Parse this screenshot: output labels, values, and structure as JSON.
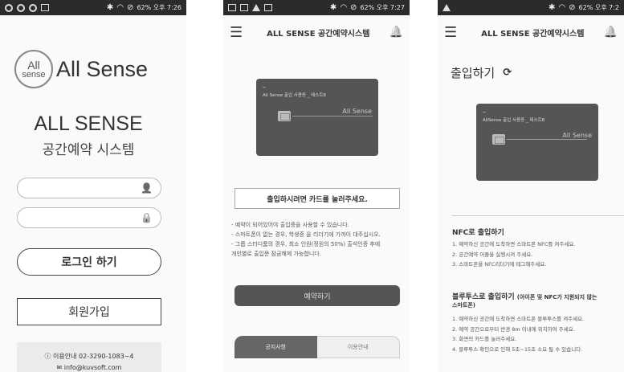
{
  "screens": {
    "login": {
      "status": {
        "right": "62%  오후 7:26"
      },
      "logo": {
        "circle_line1": "All",
        "circle_line2": "sense",
        "text": "All Sense"
      },
      "title": "ALL SENSE",
      "subtitle": "공간예약 시스템",
      "id_field": {
        "value": "",
        "placeholder": "",
        "icon": "person-icon"
      },
      "pw_field": {
        "value": "",
        "placeholder": "",
        "icon": "lock-icon"
      },
      "login_button": "로그인 하기",
      "join_button": "회원가입",
      "contact_line1": "이용안내 02-3290-1083~4",
      "contact_line2": "info@kuvsoft.com"
    },
    "card": {
      "status": {
        "right": "62%  오후 7:27"
      },
      "appbar_title": "ALL SENSE 공간예약시스템",
      "card": {
        "dash": "–",
        "text": "All Sense 출입 사용증 _ 테스트8",
        "brand": "All Sense"
      },
      "notice": "출입하시려면 카드를 눌러주세요.",
      "notes": [
        "- 예약이 되어있어야 출입증을 사용할 수 있습니다.",
        "- 스마트폰이 없는 경우, 학생증 을 리더기에 가까이 대주십시오.",
        "- 그룹 스터디룸의 경우, 최소 인원(정원의 50%) 출석인증 후에",
        "개인별로 출입문 잠금해제 가능합니다."
      ],
      "reserve_button": "예약하기",
      "tabs": [
        "공지사항",
        "이용안내"
      ]
    },
    "entry": {
      "status": {
        "right": "62%  오후 7:2"
      },
      "appbar_title": "ALL SENSE 공간예약시스템",
      "heading": "출입하기",
      "card": {
        "dash": "–",
        "text": "AllSense 출입 사용증 _ 테스트8",
        "brand": "All Sense"
      },
      "nfc_title": "NFC로 출입하기",
      "nfc_steps": [
        "1. 예약하신 공간에 도착하면 스마트폰 NFC를 켜주세요.",
        "2. 공간예약 어플을 실행시켜 주세요.",
        "3. 스마트폰을 NFC리더기에 태그해주세요."
      ],
      "bt_title": "블루투스로 출입하기",
      "bt_title_note": "(아이폰 및 NFC가 지원되지 않는",
      "bt_title_note2": "스마트폰)",
      "bt_steps": [
        "1. 예약하신 공간에 도착하면 스마트폰 블루투스를 켜주세요.",
        "2. 예약 공간으로부터 반경 8m 이내에 위치하여 주세요.",
        "3. 화면의 카드를 눌러주세요.",
        "4. 블루투스 확인으로 인해 5초~15초 소요 될 수 있습니다."
      ]
    }
  }
}
